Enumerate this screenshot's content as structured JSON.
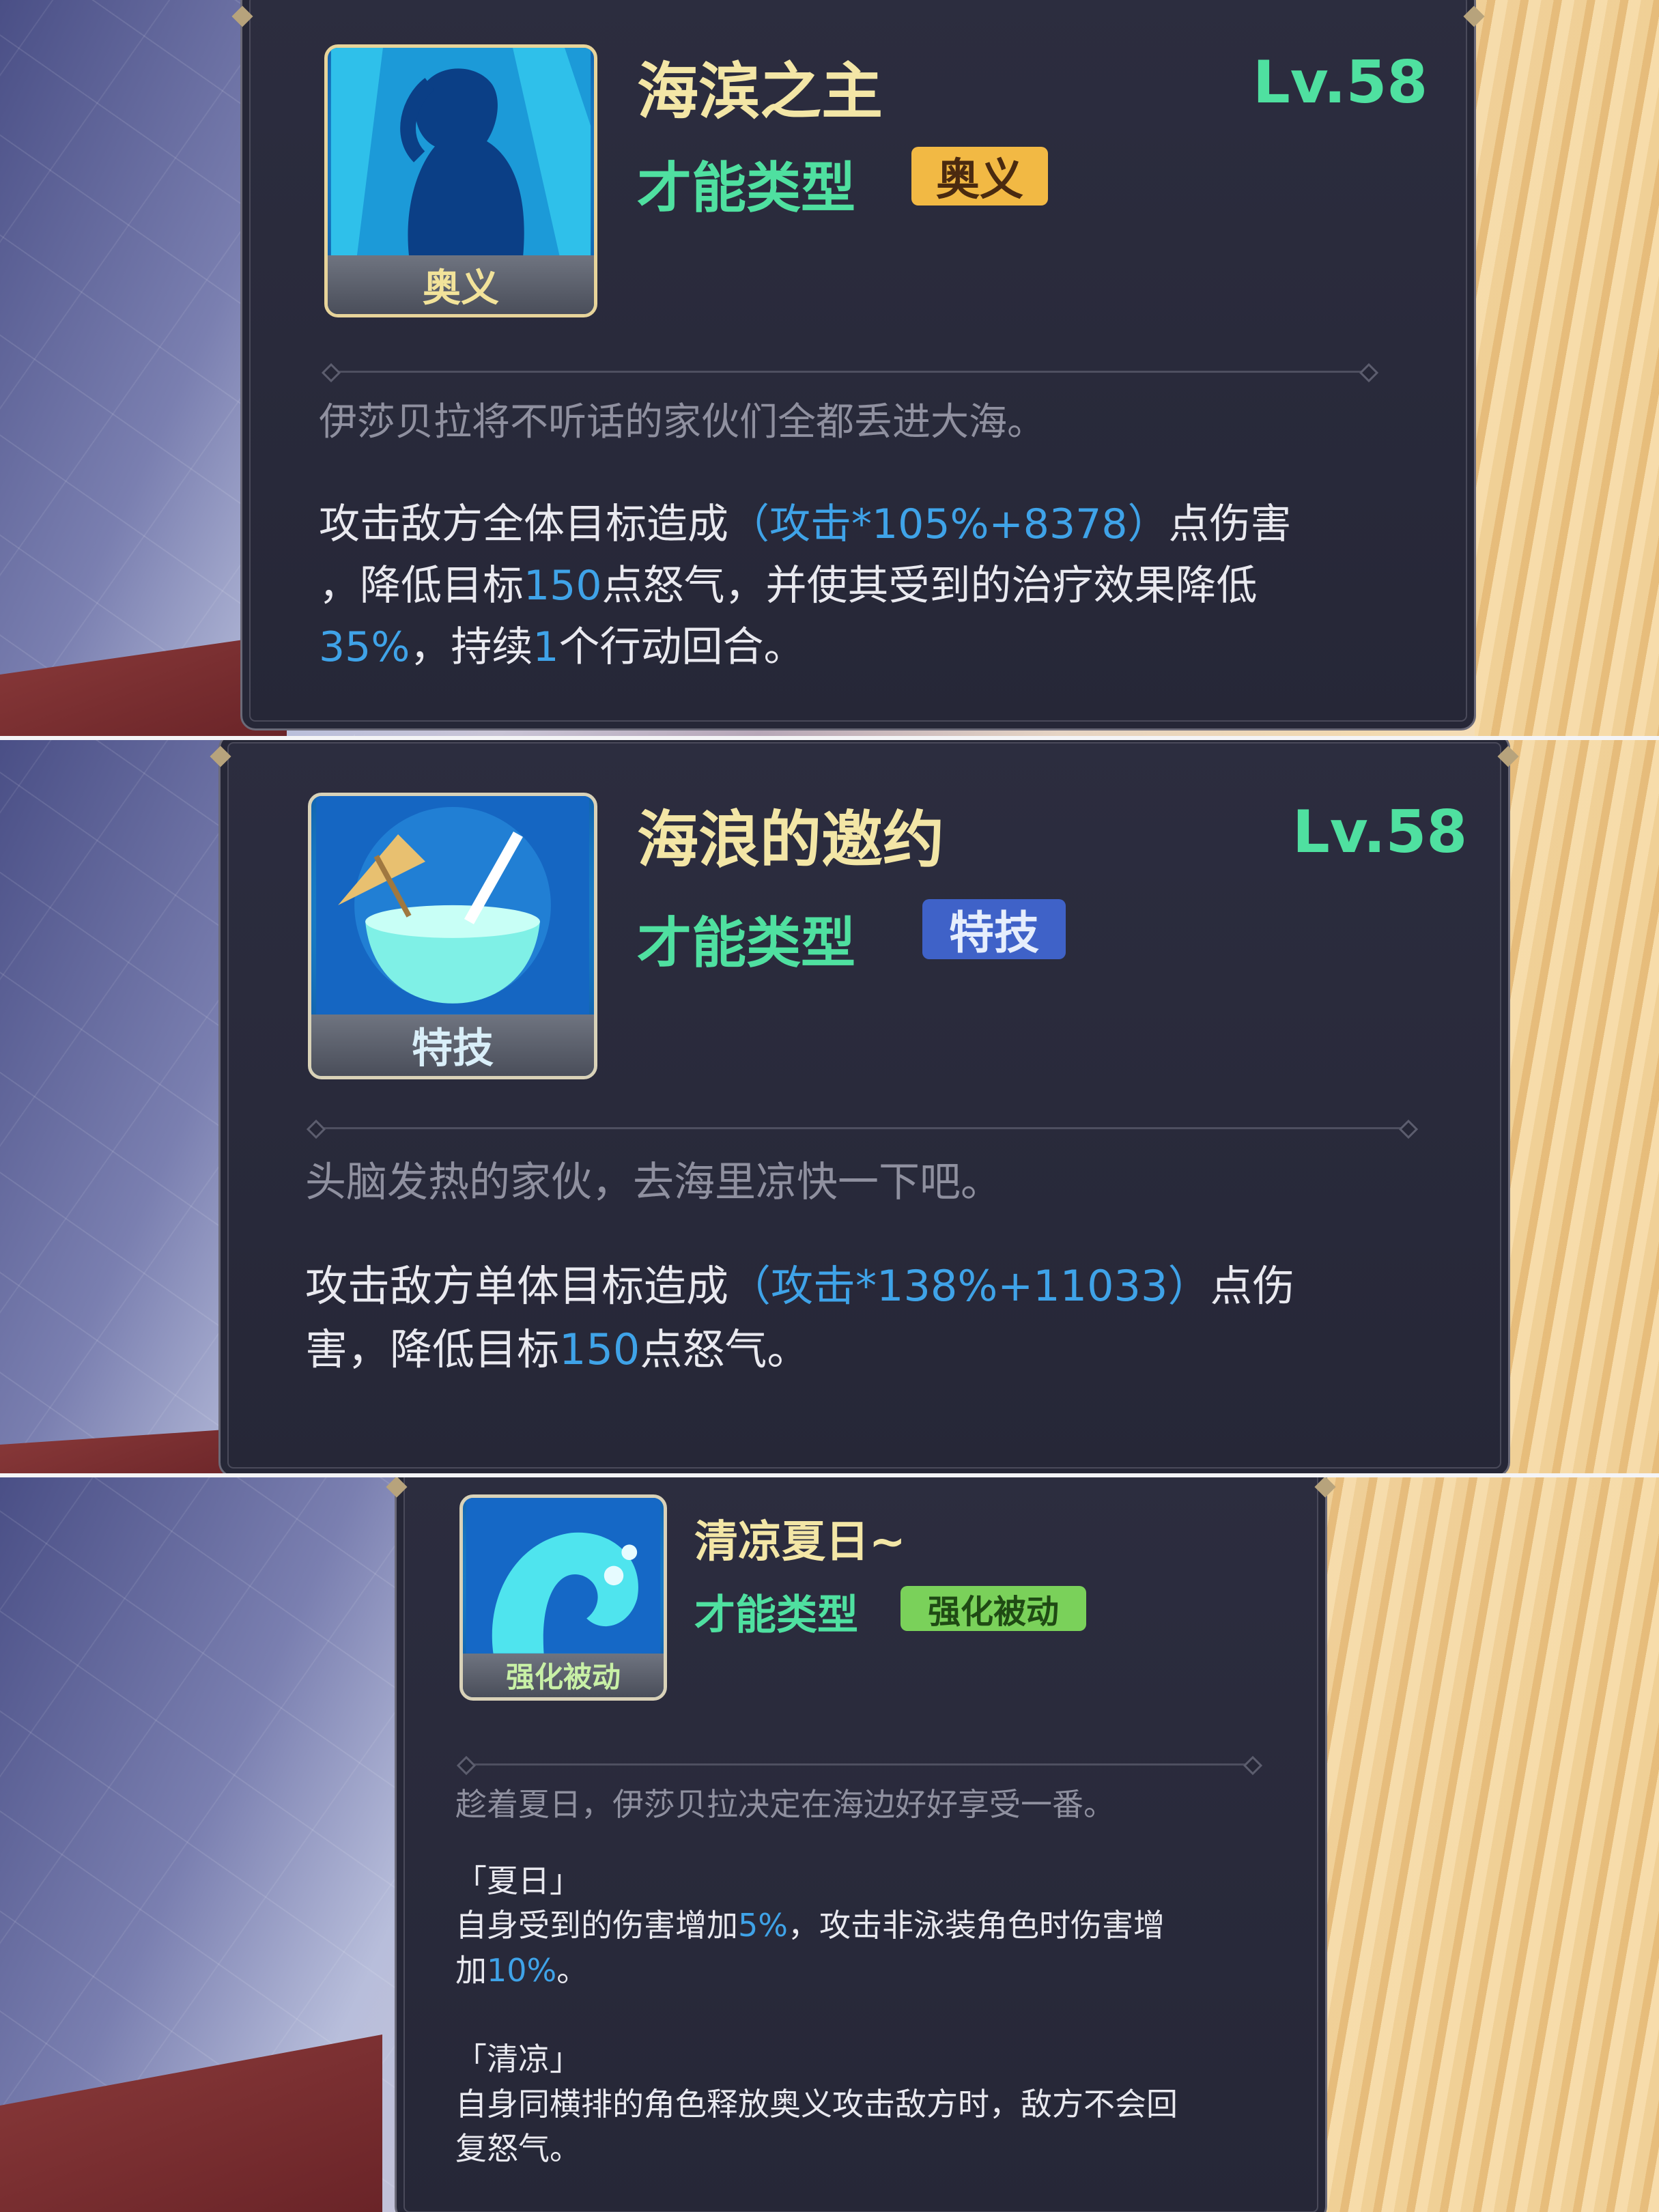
{
  "skills": [
    {
      "name": "海滨之主",
      "level": "Lv.58",
      "type_label": "才能类型",
      "type_badge": "奥义",
      "icon_label": "奥义",
      "icon": "silhouette-woman-icon",
      "flavor": "伊莎贝拉将不听话的家伙们全都丢进大海。",
      "desc_lines": [
        [
          "攻击敌方全体目标造成",
          "（攻击*105%+8378）",
          "点伤害"
        ],
        [
          "，降低目标",
          "150",
          "点怒气，并使其受到的治疗效果降低"
        ],
        [
          "35%",
          "，持续",
          "1",
          "个行动回合。"
        ]
      ]
    },
    {
      "name": "海浪的邀约",
      "level": "Lv.58",
      "type_label": "才能类型",
      "type_badge": "特技",
      "icon_label": "特技",
      "icon": "coconut-drink-icon",
      "flavor": "头脑发热的家伙，去海里凉快一下吧。",
      "desc_lines": [
        [
          "攻击敌方单体目标造成",
          "（攻击*138%+11033）",
          "点伤"
        ],
        [
          "害，降低目标",
          "150",
          "点怒气。"
        ]
      ]
    },
    {
      "name": "清凉夏日~",
      "type_label": "才能类型",
      "type_badge": "强化被动",
      "icon_label": "强化被动",
      "icon": "wave-icon",
      "flavor": "趁着夏日，伊莎贝拉决定在海边好好享受一番。",
      "sections": [
        {
          "heading": "「夏日」",
          "lines": [
            [
              "自身受到的伤害增加",
              "5%",
              "，攻击非泳装角色时伤害增"
            ],
            [
              "加",
              "10%",
              "。"
            ]
          ]
        },
        {
          "heading": "「清凉」",
          "lines": [
            [
              "自身同横排的角色释放奥义攻击敌方时，敌方不会回"
            ],
            [
              "复怒气。"
            ]
          ]
        }
      ]
    }
  ],
  "colors": {
    "title": "#f3e6a6",
    "level": "#4fe0a0",
    "highlight": "#3fa3e8",
    "badge_gold": "#f2b944",
    "badge_blue": "#3f62c8",
    "badge_green": "#7ad15a"
  }
}
